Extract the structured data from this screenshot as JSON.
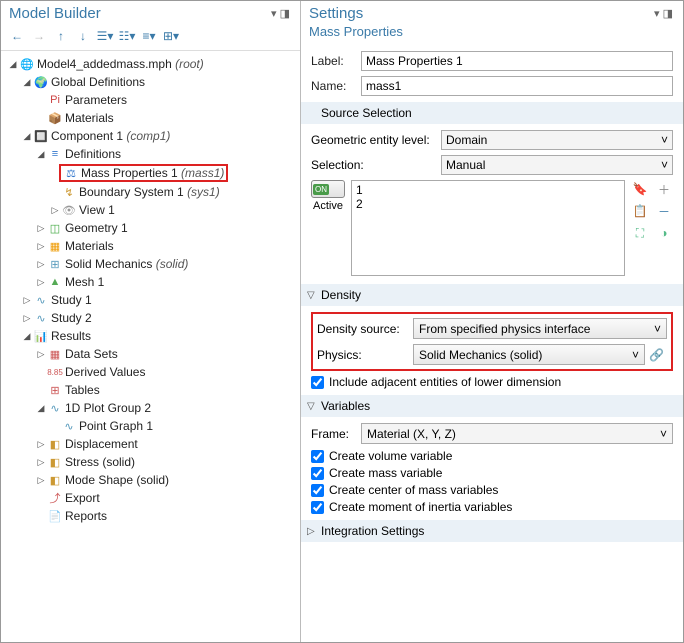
{
  "left": {
    "title": "Model Builder",
    "tree": {
      "root": "Model4_addedmass.mph",
      "rootSuffix": "(root)",
      "globalDefs": "Global Definitions",
      "parameters": "Parameters",
      "materials": "Materials",
      "component": "Component 1",
      "componentSuffix": "(comp1)",
      "definitions": "Definitions",
      "massProps": "Mass Properties 1",
      "massPropsSuffix": "(mass1)",
      "boundarySys": "Boundary System 1",
      "boundarySysSuffix": "(sys1)",
      "view": "View 1",
      "geometry": "Geometry 1",
      "materials2": "Materials",
      "solid": "Solid Mechanics",
      "solidSuffix": "(solid)",
      "mesh": "Mesh 1",
      "study1": "Study 1",
      "study2": "Study 2",
      "results": "Results",
      "datasets": "Data Sets",
      "derived": "Derived Values",
      "tables": "Tables",
      "plotgrp": "1D Plot Group 2",
      "pointgraph": "Point Graph 1",
      "displacement": "Displacement",
      "stress": "Stress (solid)",
      "modeshape": "Mode Shape (solid)",
      "export": "Export",
      "reports": "Reports"
    }
  },
  "right": {
    "title": "Settings",
    "subtitle": "Mass Properties",
    "labelLbl": "Label:",
    "labelVal": "Mass Properties 1",
    "nameLbl": "Name:",
    "nameVal": "mass1",
    "sourceSel": "Source Selection",
    "geomLevel": "Geometric entity level:",
    "geomVal": "Domain",
    "selection": "Selection:",
    "selectionVal": "Manual",
    "active": "Active",
    "list1": "1",
    "list2": "2",
    "densityHdr": "Density",
    "densitySrc": "Density source:",
    "densitySrcVal": "From specified physics interface",
    "physics": "Physics:",
    "physicsVal": "Solid Mechanics (solid)",
    "includeAdj": "Include adjacent entities of lower dimension",
    "variablesHdr": "Variables",
    "frame": "Frame:",
    "frameVal": "Material  (X, Y, Z)",
    "cv1": "Create volume variable",
    "cv2": "Create mass variable",
    "cv3": "Create center of mass variables",
    "cv4": "Create moment of inertia variables",
    "integHdr": "Integration Settings"
  }
}
